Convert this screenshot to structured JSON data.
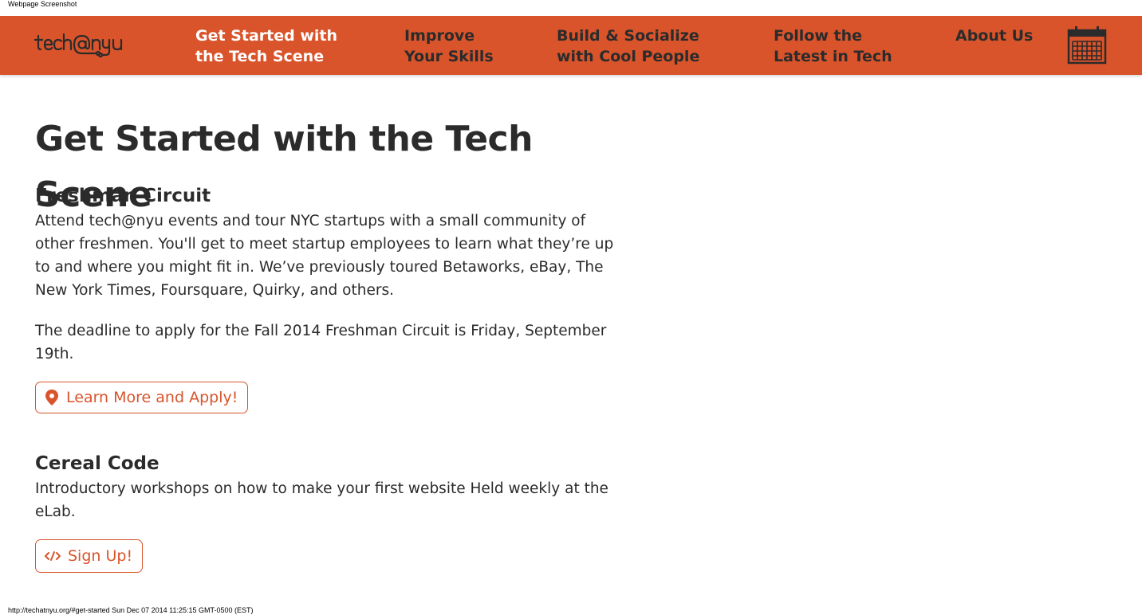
{
  "capture": {
    "header_text": "Webpage Screenshot",
    "footer_text": "http://techatnyu.org/#get-started Sun Dec 07 2014 11:25:15 GMT-0500 (EST)"
  },
  "nav": {
    "logo_text": "tech@nyu",
    "items": [
      {
        "line1": "Get Started with",
        "line2": "the Tech Scene",
        "active": true
      },
      {
        "line1": "Improve",
        "line2": "Your Skills",
        "active": false
      },
      {
        "line1": "Build & Socialize",
        "line2": "with Cool People",
        "active": false
      },
      {
        "line1": "Follow the",
        "line2": "Latest in Tech",
        "active": false
      },
      {
        "line1": "About Us",
        "line2": "",
        "active": false
      }
    ],
    "calendar_icon": "calendar-icon"
  },
  "main": {
    "title": "Get Started with the Tech Scene",
    "sections": [
      {
        "title": "Freshman Circuit",
        "paragraphs": [
          "Attend tech@nyu events and tour NYC startups with a small community of other freshmen. You'll get to meet startup employees to learn what they’re up to and where you might fit in. We’ve previously toured Betaworks, eBay, The New York Times, Foursquare, Quirky, and others.",
          "The deadline to apply for the Fall 2014 Freshman Circuit is Friday, September 19th."
        ],
        "button_label": "Learn More and Apply!",
        "button_icon": "map-pin-icon"
      },
      {
        "title": "Cereal Code",
        "paragraphs": [
          "Introductory workshops on how to make your first website Held weekly at the eLab."
        ],
        "button_label": "Sign Up!",
        "button_icon": "code-icon"
      }
    ]
  },
  "colors": {
    "brand_orange": "#d9542b",
    "nav_text": "#2b2b2b",
    "nav_active_text": "#ffffff",
    "body_text": "#2b2b2b"
  }
}
